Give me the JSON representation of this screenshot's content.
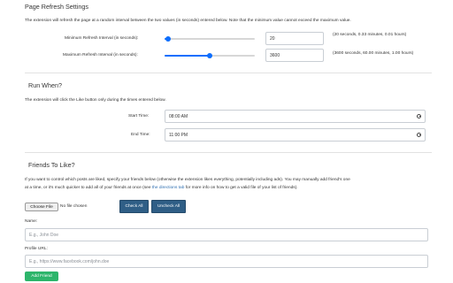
{
  "page_refresh": {
    "title": "Page Refresh Settings",
    "description": "The extension will refresh the page at a random interval between the two values (in seconds) entered below. Note that the minimum value cannot exceed the maximum value.",
    "min": {
      "label": "Minimum Refresh Interval (in seconds):",
      "value": "20",
      "note": "(20 seconds, 0.33 minutes, 0.01 hours)",
      "slider_fraction": 0.04
    },
    "max": {
      "label": "Maximum Refresh Interval (in seconds):",
      "value": "3600",
      "note": "(3600 seconds, 60.00 minutes, 1.00 hours)",
      "slider_fraction": 0.5
    }
  },
  "run_when": {
    "title": "Run When?",
    "description": "The extension will click the Like button only during the times entered below.",
    "start": {
      "label": "Start Time:",
      "value": "08:00 AM"
    },
    "end": {
      "label": "End Time:",
      "value": "11:00 PM"
    }
  },
  "friends": {
    "title": "Friends To Like?",
    "description_line1": "If you want to control which posts are liked, specify your friends below (otherwise the extension likes everything, potentially including ads). You may manually add friend's one",
    "description_line2_pre": "at a time, or it's much quicker to add all of your friends at once (see ",
    "description_link": "the directions tab",
    "description_line2_post": " for more info on how to get a valid file of your list of friends).",
    "choose_file_label": "Choose File",
    "no_file_label": "No file chosen",
    "check_all_label": "Check All",
    "uncheck_all_label": "Uncheck All",
    "name_label": "Name:",
    "name_placeholder": "E.g., John Doe",
    "profile_label": "Profile URL:",
    "profile_placeholder": "E.g., https://www.facebook.com/john.doe",
    "add_friend_label": "Add Friend"
  },
  "colors": {
    "accent": "#0d6efd",
    "button_dark": "#2f5e86",
    "button_green": "#2db56b",
    "link": "#2f6fb0"
  }
}
